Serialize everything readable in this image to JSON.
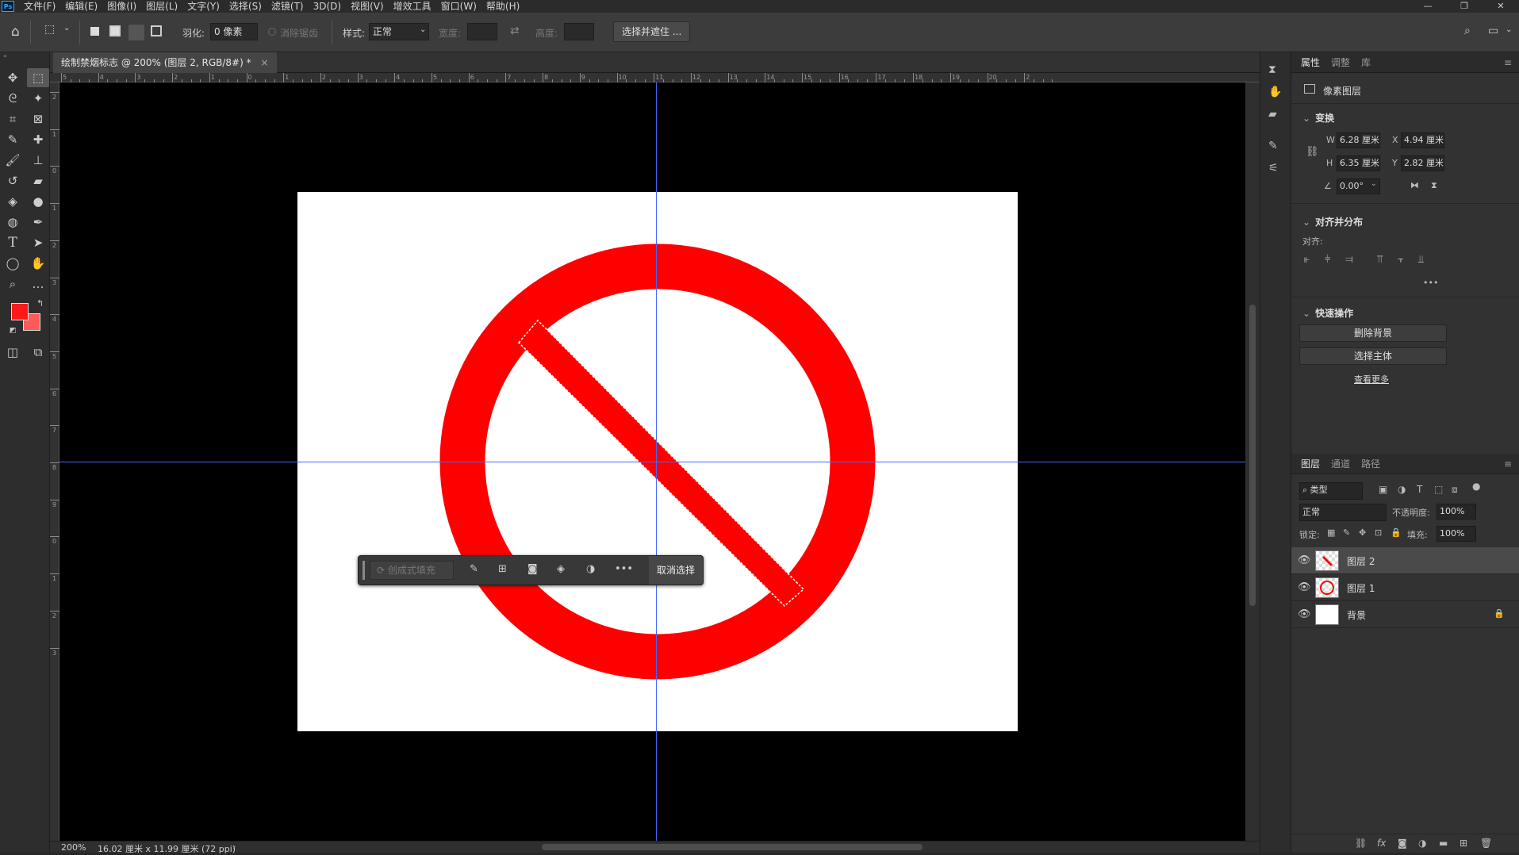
{
  "app": {
    "logo_text": "Ps",
    "menu": [
      "文件(F)",
      "编辑(E)",
      "图像(I)",
      "图层(L)",
      "文字(Y)",
      "选择(S)",
      "滤镜(T)",
      "3D(D)",
      "视图(V)",
      "增效工具",
      "窗口(W)",
      "帮助(H)"
    ],
    "window_controls": [
      "—",
      "❐",
      "✕"
    ]
  },
  "options_bar": {
    "feather_label": "羽化:",
    "feather_value": "0 像素",
    "antialias_label": "消除锯齿",
    "style_label": "样式:",
    "style_value": "正常",
    "width_label": "宽度:",
    "height_label": "高度:",
    "select_mask_button": "选择并遮住 ..."
  },
  "document": {
    "tab_title": "绘制禁烟标志 @ 200% (图层 2, RGB/8#) *",
    "tab_close": "×",
    "ruler_top_numbers": [
      "5",
      "4",
      "3",
      "2",
      "1",
      "0",
      "1",
      "2",
      "3",
      "4",
      "5",
      "6",
      "7",
      "8",
      "9",
      "10",
      "11",
      "12",
      "13",
      "14",
      "15",
      "16",
      "17",
      "18",
      "19",
      "20",
      "2"
    ],
    "ruler_left_numbers": [
      "2",
      "1",
      "0",
      "1",
      "2",
      "3",
      "4",
      "5",
      "6",
      "7",
      "8",
      "9",
      "0",
      "1",
      "2",
      "3"
    ],
    "colors": {
      "sign_red": "#ff0000",
      "guide_blue": "#4169ff",
      "foreground": "#ff1a1a",
      "background": "#ff5a5a"
    }
  },
  "context_bar": {
    "generative_fill": "创成式填充",
    "deselect": "取消选择"
  },
  "properties_panel": {
    "tabs": [
      "属性",
      "调整",
      "库"
    ],
    "layer_type": "像素图层",
    "transform_title": "变换",
    "w_label": "W",
    "w_value": "6.28 厘米",
    "x_label": "X",
    "x_value": "4.94 厘米",
    "h_label": "H",
    "h_value": "6.35 厘米",
    "y_label": "Y",
    "y_value": "2.82 厘米",
    "angle_value": "0.00°",
    "align_title": "对齐并分布",
    "align_label": "对齐:",
    "quick_actions_title": "快速操作",
    "remove_bg": "删除背景",
    "select_subject": "选择主体",
    "view_more": "查看更多"
  },
  "layers_panel": {
    "tabs": [
      "图层",
      "通道",
      "路径"
    ],
    "filter_kind": "类型",
    "blend_mode": "正常",
    "opacity_label": "不透明度:",
    "opacity_value": "100%",
    "lock_label": "锁定:",
    "fill_label": "填充:",
    "fill_value": "100%",
    "layers": [
      {
        "name": "图层 2",
        "selected": true
      },
      {
        "name": "图层 1",
        "selected": false
      },
      {
        "name": "背景",
        "selected": false
      }
    ]
  },
  "status_bar": {
    "zoom": "200%",
    "doc_info": "16.02 厘米 x 11.99 厘米 (72 ppi)"
  }
}
